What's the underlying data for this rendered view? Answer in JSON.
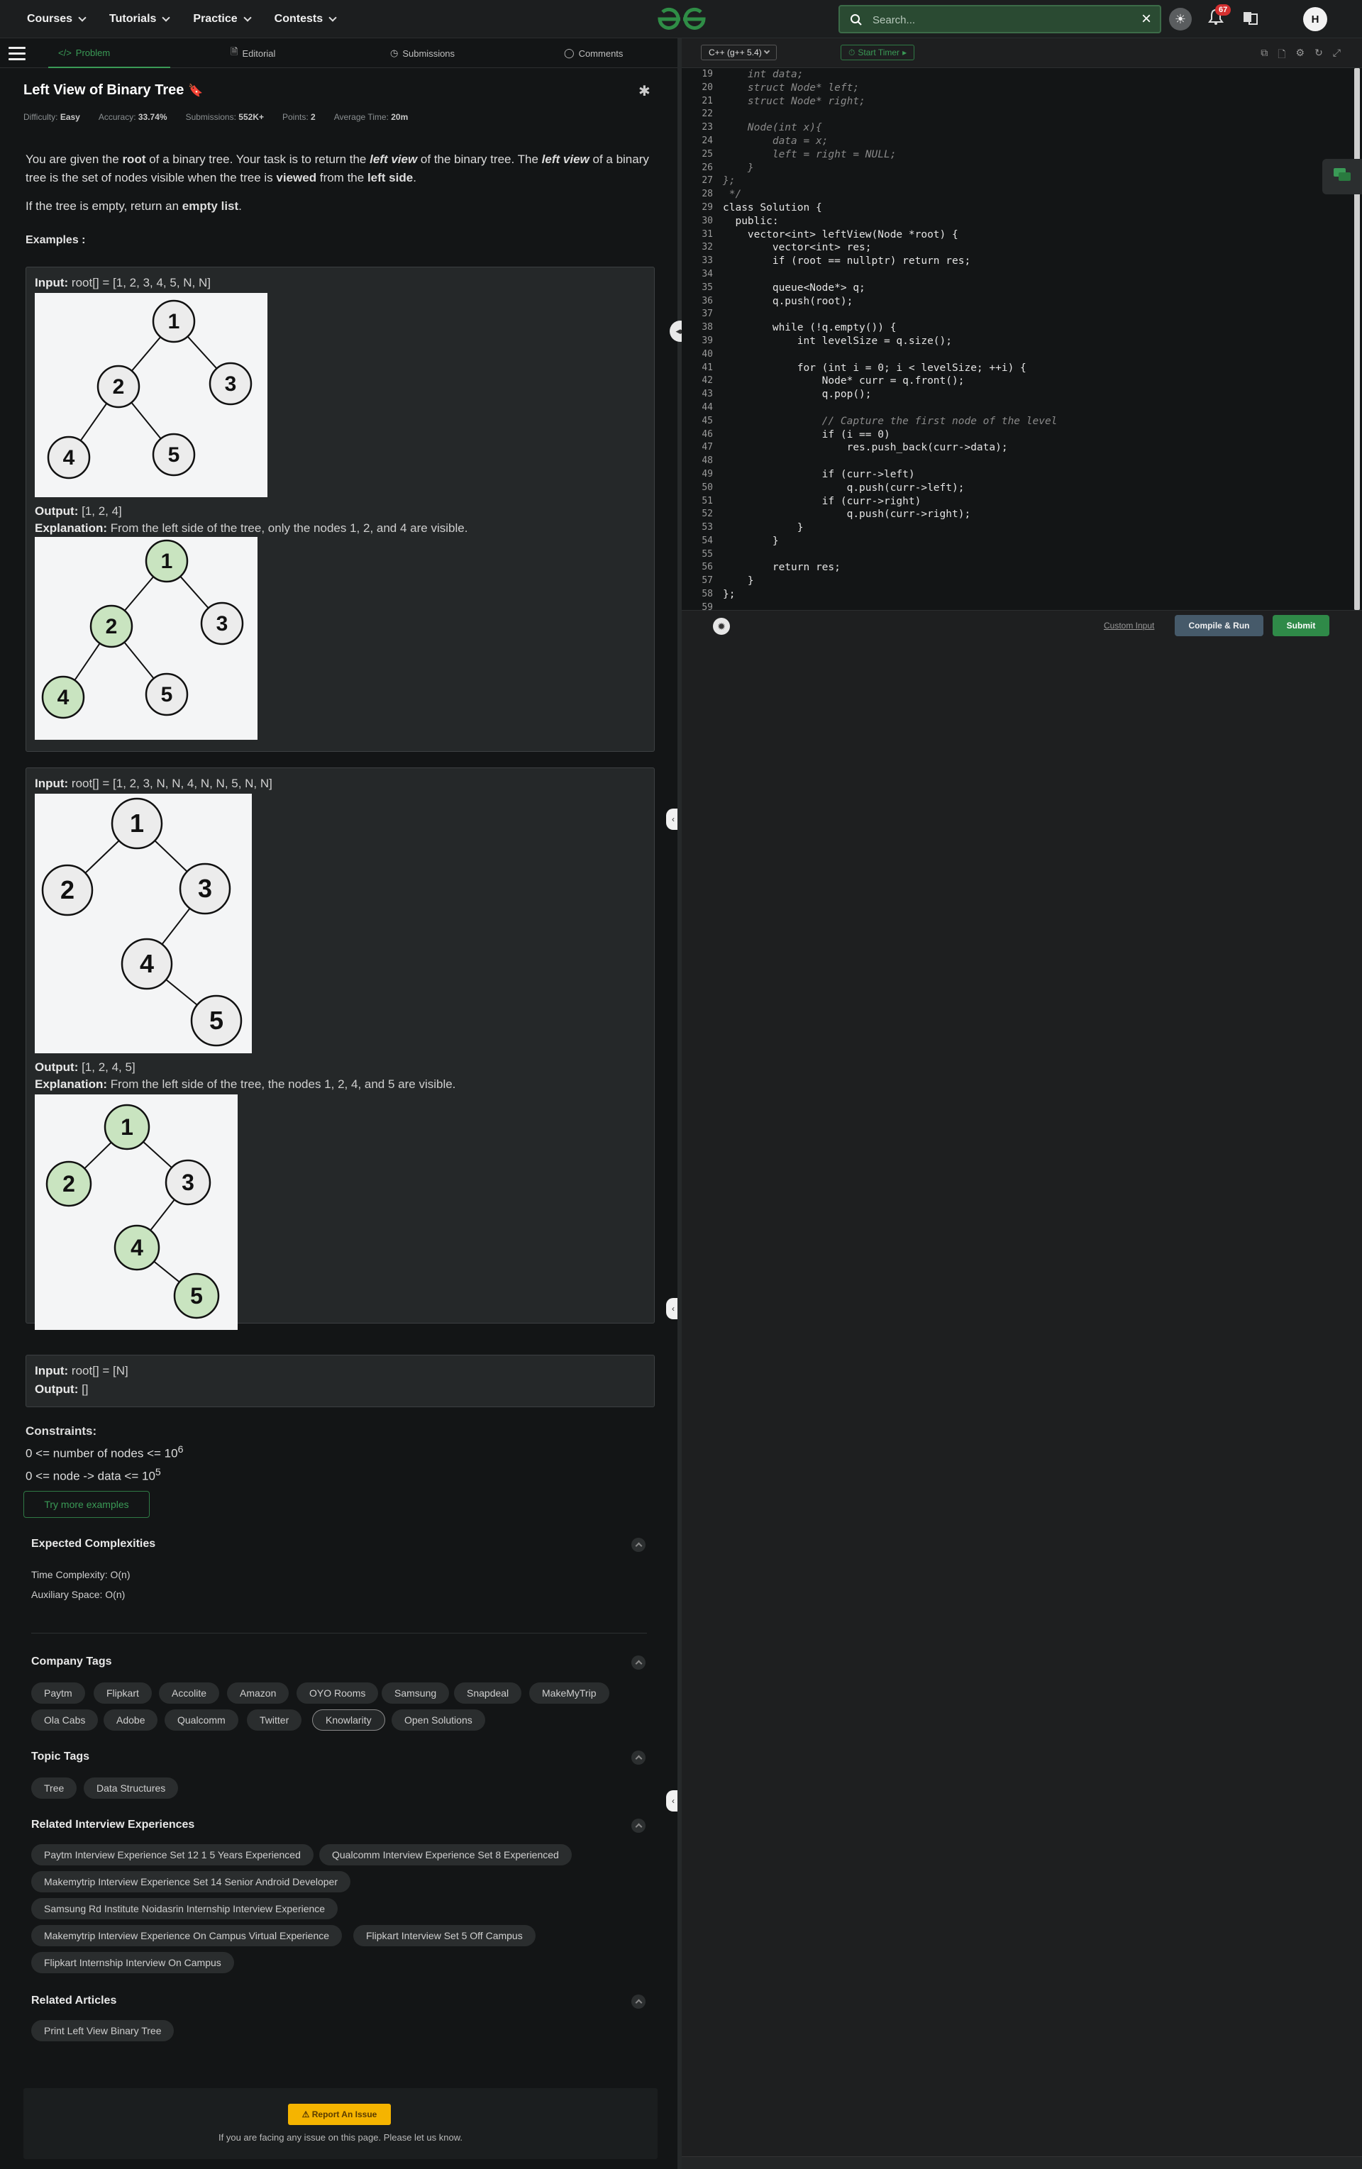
{
  "nav": {
    "items": [
      "Courses",
      "Tutorials",
      "Practice",
      "Contests"
    ],
    "search_placeholder": "Search...",
    "notif_count": "67",
    "avatar": "H"
  },
  "tabs": {
    "problem": "Problem",
    "editorial": "Editorial",
    "submissions": "Submissions",
    "comments": "Comments"
  },
  "problem": {
    "title": "Left View of Binary Tree",
    "difficulty_label": "Difficulty:",
    "difficulty": "Easy",
    "accuracy_label": "Accuracy:",
    "accuracy": "33.74%",
    "submissions_label": "Submissions:",
    "submissions": "552K+",
    "points_label": "Points:",
    "points": "2",
    "avg_time_label": "Average Time:",
    "avg_time": "20m",
    "desc1_a": "You are given the ",
    "desc1_b": "root",
    "desc1_c": " of a binary tree. Your task is to return the ",
    "desc1_d": "left view",
    "desc1_e": " of the binary tree. The ",
    "desc1_f": "left view",
    "desc1_g": " of a binary tree is the set of nodes visible when the tree is ",
    "desc1_h": "viewed",
    "desc1_i": " from the ",
    "desc1_j": "left side",
    "desc1_k": ".",
    "desc2_a": "If the tree is empty, return an ",
    "desc2_b": "empty list",
    "desc2_c": ".",
    "examples_label": "Examples :"
  },
  "examples": [
    {
      "input_label": "Input:",
      "input": " root[] = [1, 2, 3, 4, 5, N, N]",
      "output_label": "Output:",
      "output": " [1, 2, 4]",
      "expl_label": "Explanation:",
      "expl": " From the left side of the tree, only the nodes 1, 2, and 4 are visible."
    },
    {
      "input_label": "Input:",
      "input": " root[] = [1, 2, 3, N, N, 4, N, N, 5, N, N]",
      "output_label": "Output:",
      "output": " [1, 2, 4, 5]",
      "expl_label": "Explanation:",
      "expl": " From the left side of the tree, the nodes 1, 2, 4, and 5 are visible."
    },
    {
      "input_label": "Input:",
      "input": " root[] = [N]",
      "output_label": "Output:",
      "output": " []"
    }
  ],
  "constraints": {
    "label": "Constraints:",
    "c1": "0 <= number of nodes <= 10",
    "c1_sup": "6",
    "c2": "0 <= node -> data <= 10",
    "c2_sup": "5"
  },
  "try_more": "Try more examples",
  "complexities": {
    "title": "Expected Complexities",
    "time": "Time Complexity: O(n)",
    "space": "Auxiliary Space: O(n)"
  },
  "company": {
    "title": "Company Tags",
    "tags": [
      "Paytm",
      "Flipkart",
      "Accolite",
      "Amazon",
      "OYO Rooms",
      "Samsung",
      "Snapdeal",
      "MakeMyTrip",
      "Ola Cabs",
      "Adobe",
      "Qualcomm",
      "Twitter",
      "Knowlarity",
      "Open Solutions"
    ]
  },
  "topic": {
    "title": "Topic Tags",
    "tags": [
      "Tree",
      "Data Structures"
    ]
  },
  "interviews": {
    "title": "Related Interview Experiences",
    "items": [
      "Paytm Interview Experience Set 12 1 5 Years Experienced",
      "Qualcomm Interview Experience Set 8 Experienced",
      "Makemytrip Interview Experience Set 14 Senior Android Developer",
      "Samsung Rd Institute Noidasrin Internship Interview Experience",
      "Makemytrip Interview Experience On Campus Virtual Experience",
      "Flipkart Interview Set 5 Off Campus",
      "Flipkart Internship Interview On Campus"
    ]
  },
  "articles": {
    "title": "Related Articles",
    "items": [
      "Print Left View Binary Tree"
    ]
  },
  "footer": {
    "report": "Report An Issue",
    "text": "If you are facing any issue on this page. Please let us know."
  },
  "editor": {
    "language": "C++ (g++ 5.4)",
    "timer": "Start Timer",
    "custom_input": "Custom Input",
    "compile_run": "Compile & Run",
    "submit": "Submit",
    "line_numbers": [
      "19",
      "20",
      "21",
      "22",
      "23",
      "24",
      "25",
      "26",
      "27",
      "28",
      "29",
      "30",
      "31",
      "32",
      "33",
      "34",
      "35",
      "36",
      "37",
      "38",
      "39",
      "40",
      "41",
      "42",
      "43",
      "44",
      "45",
      "46",
      "47",
      "48",
      "49",
      "50",
      "51",
      "52",
      "53",
      "54",
      "55",
      "56",
      "57",
      "58",
      "59"
    ],
    "lines": [
      "    int data;",
      "    struct Node* left;",
      "    struct Node* right;",
      "",
      "    Node(int x){",
      "        data = x;",
      "        left = right = NULL;",
      "    }",
      "};",
      " */",
      "class Solution {",
      "  public:",
      "    vector<int> leftView(Node *root) {",
      "        vector<int> res;",
      "        if (root == nullptr) return res;",
      "",
      "        queue<Node*> q;",
      "        q.push(root);",
      "",
      "        while (!q.empty()) {",
      "            int levelSize = q.size();",
      "",
      "            for (int i = 0; i < levelSize; ++i) {",
      "                Node* curr = q.front();",
      "                q.pop();",
      "",
      "                // Capture the first node of the level",
      "                if (i == 0)",
      "                    res.push_back(curr->data);",
      "",
      "                if (curr->left)",
      "                    q.push(curr->left);",
      "                if (curr->right)",
      "                    q.push(curr->right);",
      "            }",
      "        }",
      "",
      "        return res;",
      "    }",
      "};",
      ""
    ]
  },
  "trees": {
    "t1": [
      "1",
      "2",
      "3",
      "4",
      "5"
    ],
    "t2": [
      "1",
      "2",
      "3",
      "4",
      "5"
    ]
  },
  "colors": {
    "accent": "#3a9a56",
    "node_highlight": "#c9e4c0",
    "node_plain": "#ececec"
  }
}
